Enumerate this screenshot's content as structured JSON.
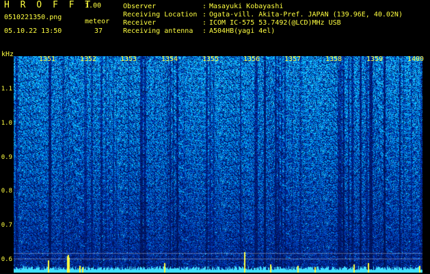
{
  "app": {
    "title": "H R O F F T",
    "version": "1.00"
  },
  "file_name": "0510221350.png",
  "datetime": "05.10.22 13:50",
  "meteor": {
    "label": "meteor",
    "count": "37"
  },
  "info": [
    {
      "key": "Observer",
      "value": "Masayuki Kobayashi"
    },
    {
      "key": "Receiving Location",
      "value": "Ogata-vill. Akita-Pref. JAPAN (139.96E, 40.02N)"
    },
    {
      "key": "Receiver",
      "value": "ICOM IC-575 53.7492(@LCD)MHz USB"
    },
    {
      "key": "Receiving antenna",
      "value": "A504HB(yagi 4el)"
    }
  ],
  "separator": ":",
  "axis": {
    "y_unit": "kHz",
    "y_ticks": [
      "1.1",
      "1.0",
      "0.9",
      "0.8",
      "0.7",
      "0.6"
    ],
    "x_ticks": [
      "1351",
      "1352",
      "1353",
      "1354",
      "1355",
      "1356",
      "1357",
      "1358",
      "1359",
      "1400"
    ]
  },
  "colors": {
    "label": "#ffff40",
    "background": "#000000",
    "baseline": "#40e0ff",
    "echo": "#ffff40"
  }
}
